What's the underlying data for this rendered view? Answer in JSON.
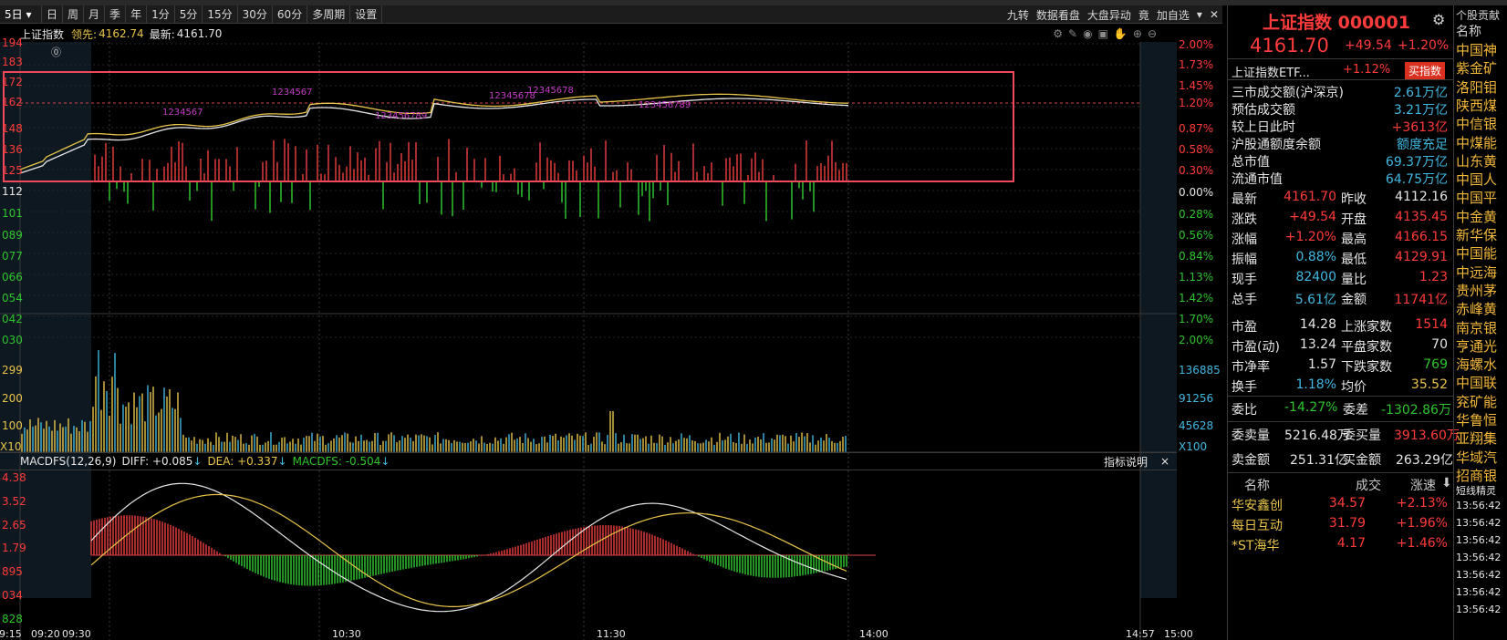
{
  "toolbar": {
    "left_combo": "5日",
    "periods": [
      "日",
      "周",
      "月",
      "季",
      "年",
      "1分",
      "5分",
      "15分",
      "30分",
      "60分",
      "多周期",
      "设置"
    ],
    "right_items": [
      "九转",
      "数据看盘",
      "大盘异动",
      "竟",
      "加自选"
    ]
  },
  "info": {
    "name": "上证指数",
    "lead_label": "领先:",
    "lead_value": "4162.74",
    "latest_label": "最新:",
    "latest_value": "4161.70"
  },
  "axis": {
    "left_price": [
      "194",
      "183",
      "172",
      "162",
      "148",
      "136",
      "125",
      "112",
      "101",
      "089",
      "077",
      "066",
      "054",
      "042",
      "030"
    ],
    "right_pct": [
      "2.00%",
      "1.73%",
      "1.45%",
      "1.20%",
      "0.87%",
      "0.58%",
      "0.30%",
      "0.00%",
      "0.28%",
      "0.56%",
      "0.84%",
      "1.13%",
      "1.42%",
      "1.70%",
      "2.00%"
    ],
    "left_vol": [
      "299",
      "200",
      "100"
    ],
    "left_vol_mult": "X10",
    "right_vol": [
      "136885",
      "91256",
      "45628"
    ],
    "right_vol_mult": "X100",
    "macd_left": [
      "4.38",
      "3.52",
      "2.65",
      "1.79",
      "895",
      "034",
      "828"
    ],
    "time_labels": [
      "09:15",
      "09:20",
      "09:30",
      "10:30",
      "11:30",
      "14:00",
      "14:57",
      "15:00"
    ]
  },
  "macd": {
    "title": "MACDFS(12,26,9)",
    "diff": "DIFF: +0.085",
    "dea": "DEA: +0.337",
    "macdfs": "MACDFS: -0.504",
    "explain": "指标说明",
    "close": "×"
  },
  "quote": {
    "title": "上证指数 000001",
    "price": "4161.70",
    "change": "+49.54",
    "pct": "+1.20%",
    "etf_name": "上证指数ETF...",
    "etf_pct": "+1.12%",
    "etf_button": "买指数",
    "summary": [
      {
        "label": "三市成交额(沪深京)",
        "value": "2.61万亿"
      },
      {
        "label": "预估成交额",
        "value": "3.21万亿"
      },
      {
        "label": "较上日此时",
        "value": "+3613亿"
      },
      {
        "label": "沪股通额度余额",
        "value": "额度充足"
      },
      {
        "label": "总市值",
        "value": "69.37万亿"
      },
      {
        "label": "流通市值",
        "value": "64.75万亿"
      }
    ],
    "grid": [
      {
        "l1": "最新",
        "v1": "4161.70",
        "l2": "昨收",
        "v2": "4112.16"
      },
      {
        "l1": "涨跌",
        "v1": "+49.54",
        "l2": "开盘",
        "v2": "4135.45"
      },
      {
        "l1": "涨幅",
        "v1": "+1.20%",
        "l2": "最高",
        "v2": "4166.15"
      },
      {
        "l1": "振幅",
        "v1": "0.88%",
        "l2": "最低",
        "v2": "4129.91"
      },
      {
        "l1": "现手",
        "v1": "82400",
        "l2": "量比",
        "v2": "1.23"
      },
      {
        "l1": "总手",
        "v1": "5.61亿",
        "l2": "金额",
        "v2": "11741亿"
      },
      {
        "l1": "市盈",
        "v1": "14.28",
        "l2": "上涨家数",
        "v2": "1514"
      },
      {
        "l1": "市盈(动)",
        "v1": "13.24",
        "l2": "平盘家数",
        "v2": "70"
      },
      {
        "l1": "市净率",
        "v1": "1.57",
        "l2": "下跌家数",
        "v2": "769"
      },
      {
        "l1": "换手",
        "v1": "1.18%",
        "l2": "均价",
        "v2": "35.52"
      }
    ],
    "weibi": {
      "l1": "委比",
      "v1": "-14.27%",
      "l2": "委差",
      "v2": "-1302.86万"
    },
    "orders": [
      {
        "l1": "委卖量",
        "v1": "5216.48万",
        "l2": "委买量",
        "v2": "3913.60万"
      },
      {
        "l1": "卖金额",
        "v1": "251.31亿",
        "l2": "买金额",
        "v2": "263.29亿"
      }
    ],
    "list_header": {
      "name": "名称",
      "price": "成交",
      "speed": "涨速"
    },
    "list": [
      {
        "name": "华安鑫创",
        "price": "34.57",
        "speed": "+2.13%"
      },
      {
        "name": "每日互动",
        "price": "31.79",
        "speed": "+1.96%"
      },
      {
        "name": "*ST海华",
        "price": "4.17",
        "speed": "+1.46%"
      }
    ]
  },
  "funds": {
    "header": "个股贡献",
    "subheader": "名称",
    "items": [
      "中国神",
      "紫金矿",
      "洛阳钼",
      "陕西煤",
      "中信银",
      "中煤能",
      "山东黄",
      "中国人",
      "中国平",
      "中金黄",
      "新华保",
      "中国能",
      "中远海",
      "贵州茅",
      "赤峰黄",
      "南京银",
      "亨通光",
      "海螺水",
      "中国联",
      "兖矿能",
      "华鲁恒",
      "亚翔集",
      "华域汽",
      "招商银"
    ],
    "short_title": "短线精灵",
    "times": [
      "13:56:42",
      "13:56:42",
      "13:56:42",
      "13:56:42",
      "13:56:42",
      "13:56:42",
      "13:56:42"
    ]
  }
}
